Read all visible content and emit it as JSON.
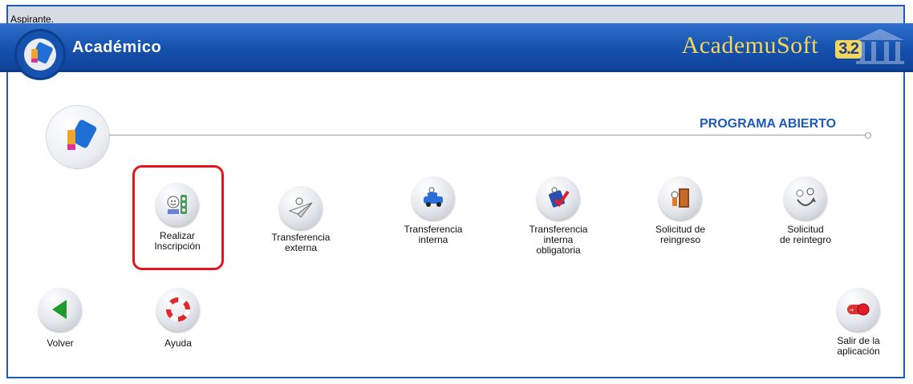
{
  "status_text": "Aspirante.",
  "header": {
    "module_title": "Académico",
    "brand": "AcademuSoft",
    "version": "3.2"
  },
  "section": {
    "title": "PROGRAMA ABIERTO"
  },
  "options": [
    {
      "label": "Realizar\nInscripción",
      "icon": "user-forms-icon"
    },
    {
      "label": "Transferencia\nexterna",
      "icon": "paper-plane-icon"
    },
    {
      "label": "Transferencia\ninterna",
      "icon": "car-icon"
    },
    {
      "label": "Transferencia\ninterna\nobligatoria",
      "icon": "checkmark-icon"
    },
    {
      "label": "Solicitud de\nreingreso",
      "icon": "door-icon"
    },
    {
      "label": "Solicitud\nde reintegro",
      "icon": "return-arrow-icon"
    }
  ],
  "footer": {
    "back_label": "Volver",
    "help_label": "Ayuda",
    "exit_label": "Salir de la\naplicación"
  },
  "colors": {
    "header_blue": "#1551ad",
    "brand_gold": "#f3d65a",
    "section_title": "#1e5bb8",
    "highlight": "#e8141b"
  }
}
